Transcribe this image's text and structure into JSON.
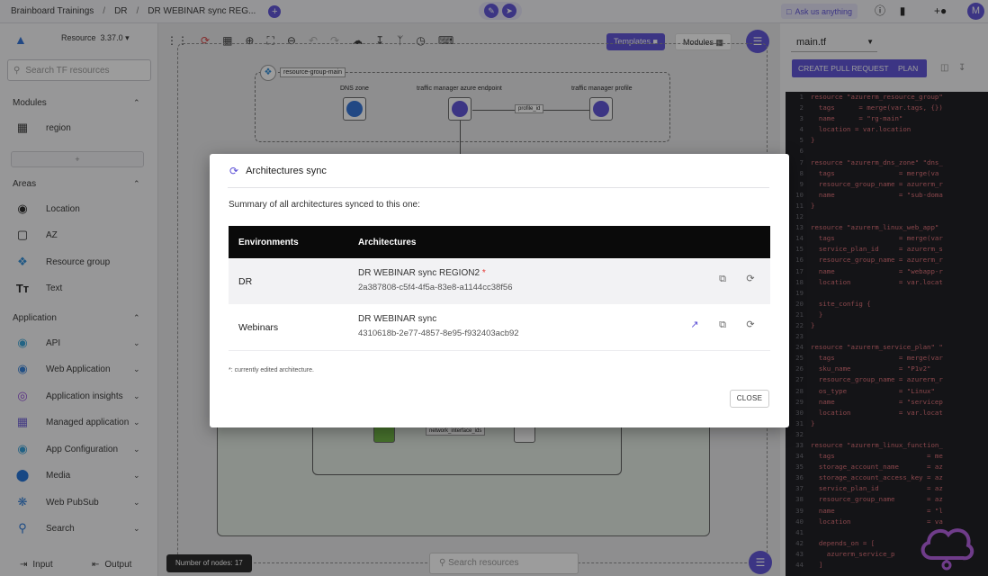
{
  "topbar": {
    "breadcrumbs": [
      "Brainboard Trainings",
      "DR",
      "DR WEBINAR sync REG..."
    ],
    "separator": "/",
    "add_icon": "plus-icon",
    "ask_label": "Ask us anything",
    "avatar_letter": "M",
    "brand_color": "#5b4fd6"
  },
  "sidebar": {
    "resource_label": "Resource",
    "version": "3.37.0",
    "search_placeholder": "Search TF resources",
    "modules": {
      "title": "Modules",
      "items": [
        {
          "label": "region",
          "icon": "terraform-icon"
        }
      ]
    },
    "add_symbol": "+",
    "areas": {
      "title": "Areas",
      "items": [
        {
          "label": "Location",
          "icon": "location-pin-icon"
        },
        {
          "label": "AZ",
          "icon": "az-square-icon"
        },
        {
          "label": "Resource group",
          "icon": "resource-group-icon"
        },
        {
          "label": "Text",
          "icon": "text-icon"
        }
      ]
    },
    "application": {
      "title": "Application",
      "items": [
        {
          "label": "API",
          "icon": "api-icon"
        },
        {
          "label": "Web Application",
          "icon": "web-app-icon"
        },
        {
          "label": "Application insights",
          "icon": "app-insights-icon"
        },
        {
          "label": "Managed application",
          "icon": "managed-app-icon"
        },
        {
          "label": "App Configuration",
          "icon": "app-config-icon"
        },
        {
          "label": "Media",
          "icon": "media-icon"
        },
        {
          "label": "Web PubSub",
          "icon": "web-pubsub-icon"
        },
        {
          "label": "Search",
          "icon": "search-service-icon"
        }
      ]
    },
    "bottom": {
      "input_label": "Input",
      "output_label": "Output"
    }
  },
  "canvas": {
    "templates_label": "Templates",
    "modules_label": "Modules",
    "resource_group_label": "resource-group-main",
    "nodes": {
      "dns_zone": "DNS zone",
      "tm_endpoint": "traffic manager azure endpoint",
      "tm_profile": "traffic manager profile"
    },
    "edge_label": "profile_id",
    "lower_edge_label": "network_interface_ids",
    "node_count_label": "Number of nodes: 17",
    "search_placeholder": "Search resources"
  },
  "right_panel": {
    "file_name": "main.tf",
    "create_pr_label": "CREATE PULL REQUEST",
    "plan_label": "PLAN",
    "code_lines": [
      {
        "n": "1",
        "t": "resource \"azurerm_resource_group\""
      },
      {
        "n": "2",
        "t": "  tags      = merge(var.tags, {})"
      },
      {
        "n": "3",
        "t": "  name      = \"rg-main\""
      },
      {
        "n": "4",
        "t": "  location = var.location"
      },
      {
        "n": "5",
        "t": "}"
      },
      {
        "n": "6",
        "t": ""
      },
      {
        "n": "7",
        "t": "resource \"azurerm_dns_zone\" \"dns_"
      },
      {
        "n": "8",
        "t": "  tags                = merge(va"
      },
      {
        "n": "9",
        "t": "  resource_group_name = azurerm_r"
      },
      {
        "n": "10",
        "t": "  name                = \"sub-doma"
      },
      {
        "n": "11",
        "t": "}"
      },
      {
        "n": "12",
        "t": ""
      },
      {
        "n": "13",
        "t": "resource \"azurerm_linux_web_app\""
      },
      {
        "n": "14",
        "t": "  tags                = merge(var"
      },
      {
        "n": "15",
        "t": "  service_plan_id     = azurerm_s"
      },
      {
        "n": "16",
        "t": "  resource_group_name = azurerm_r"
      },
      {
        "n": "17",
        "t": "  name                = \"webapp-r"
      },
      {
        "n": "18",
        "t": "  location            = var.locat"
      },
      {
        "n": "19",
        "t": ""
      },
      {
        "n": "20",
        "t": "  site_config {"
      },
      {
        "n": "21",
        "t": "  }"
      },
      {
        "n": "22",
        "t": "}"
      },
      {
        "n": "23",
        "t": ""
      },
      {
        "n": "24",
        "t": "resource \"azurerm_service_plan\" \""
      },
      {
        "n": "25",
        "t": "  tags                = merge(var"
      },
      {
        "n": "26",
        "t": "  sku_name            = \"P1v2\""
      },
      {
        "n": "27",
        "t": "  resource_group_name = azurerm_r"
      },
      {
        "n": "28",
        "t": "  os_type             = \"Linux\""
      },
      {
        "n": "29",
        "t": "  name                = \"servicep"
      },
      {
        "n": "30",
        "t": "  location            = var.locat"
      },
      {
        "n": "31",
        "t": "}"
      },
      {
        "n": "32",
        "t": ""
      },
      {
        "n": "33",
        "t": "resource \"azurerm_linux_function_"
      },
      {
        "n": "34",
        "t": "  tags                       = me"
      },
      {
        "n": "35",
        "t": "  storage_account_name       = az"
      },
      {
        "n": "36",
        "t": "  storage_account_access_key = az"
      },
      {
        "n": "37",
        "t": "  service_plan_id            = az"
      },
      {
        "n": "38",
        "t": "  resource_group_name        = az"
      },
      {
        "n": "39",
        "t": "  name                       = \"l"
      },
      {
        "n": "40",
        "t": "  location                   = va"
      },
      {
        "n": "41",
        "t": ""
      },
      {
        "n": "42",
        "t": "  depends_on = ["
      },
      {
        "n": "43",
        "t": "    azurerm_service_p"
      },
      {
        "n": "44",
        "t": "  ]"
      }
    ]
  },
  "modal": {
    "title": "Architectures sync",
    "summary": "Summary of all architectures synced to this one:",
    "columns": [
      "Environments",
      "Architectures"
    ],
    "rows": [
      {
        "environment": "DR",
        "name": "DR WEBINAR sync REGION2",
        "marker": "*",
        "id": "2a387808-c5f4-4f5a-83e8-a1144cc38f56",
        "open_link": false
      },
      {
        "environment": "Webinars",
        "name": "DR WEBINAR sync",
        "marker": "",
        "id": "4310618b-2e77-4857-8e95-f932403acb92",
        "open_link": true
      }
    ],
    "footnote": "*: currently edited architecture.",
    "close_label": "CLOSE"
  }
}
